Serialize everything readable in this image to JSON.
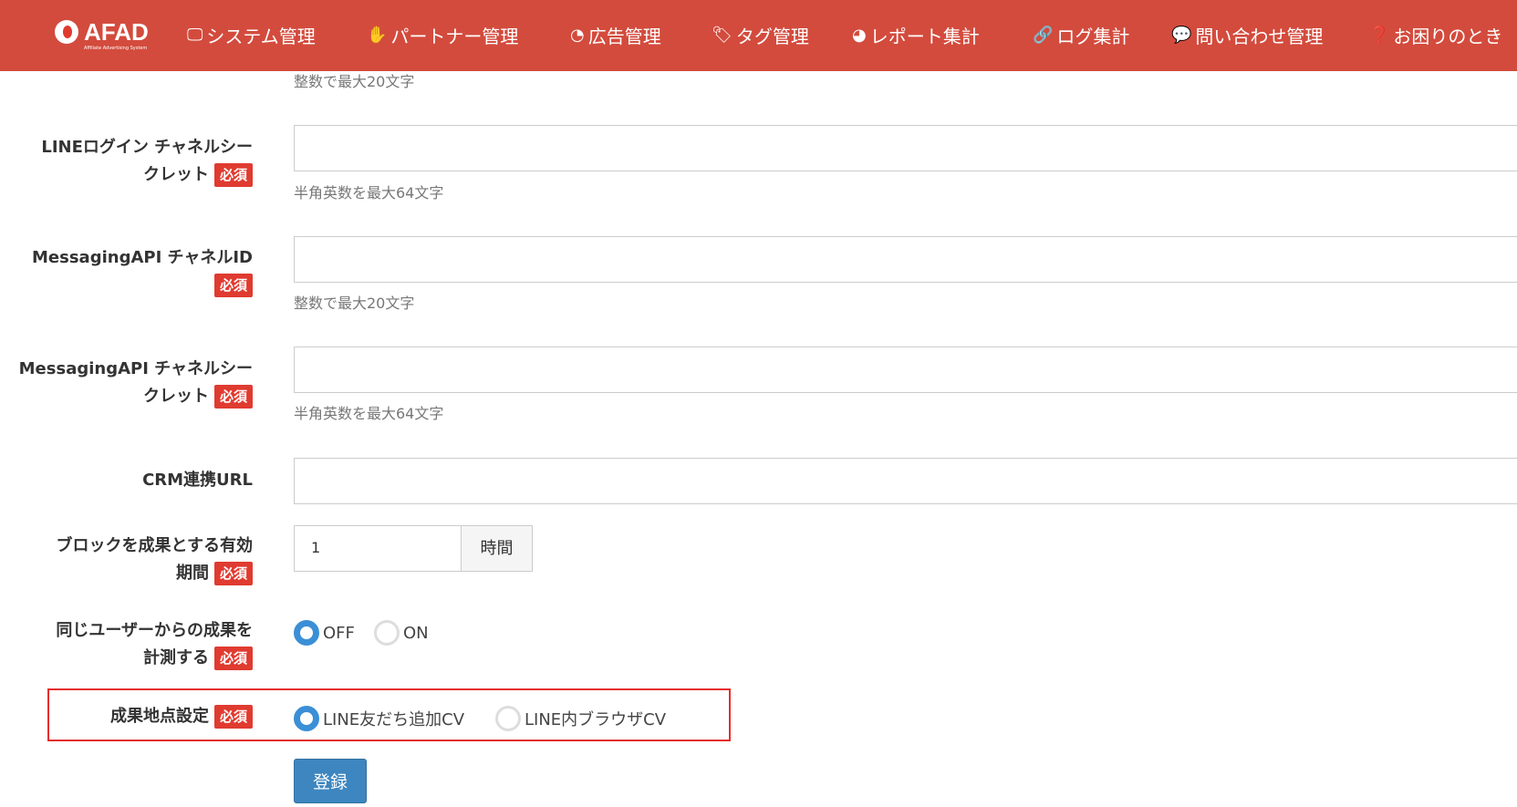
{
  "header": {
    "logo_text": "AFAD",
    "logo_subtext": "Affiliate Advertising System",
    "nav": [
      {
        "icon": "monitor-icon",
        "label": "システム管理"
      },
      {
        "icon": "handshake-icon",
        "label": "パートナー管理"
      },
      {
        "icon": "dashboard-icon",
        "label": "広告管理"
      },
      {
        "icon": "tags-icon",
        "label": "タグ管理"
      },
      {
        "icon": "pie-chart-icon",
        "label": "レポート集計"
      },
      {
        "icon": "link-icon",
        "label": "ログ集計"
      },
      {
        "icon": "comments-icon",
        "label": "問い合わせ管理"
      },
      {
        "icon": "question-circle-icon",
        "label": "お困りのとき"
      }
    ]
  },
  "required_label": "必須",
  "form": {
    "top_help": "整数で最大20文字",
    "line_login_secret": {
      "label1": "LINEログイン チャネルシー",
      "label2": "クレット",
      "value": "",
      "help": "半角英数を最大64文字"
    },
    "messaging_channel_id": {
      "label": "MessagingAPI チャネルID",
      "value": "",
      "help": "整数で最大20文字"
    },
    "messaging_secret": {
      "label1": "MessagingAPI チャネルシー",
      "label2": "クレット",
      "value": "",
      "help": "半角英数を最大64文字"
    },
    "crm_url": {
      "label": "CRM連携URL",
      "value": ""
    },
    "block_period": {
      "label1": "ブロックを成果とする有効",
      "label2": "期間",
      "value": "1",
      "unit": "時間"
    },
    "same_user": {
      "label1": "同じユーザーからの成果を",
      "label2": "計測する",
      "options": [
        "OFF",
        "ON"
      ],
      "selected": "OFF"
    },
    "conversion_point": {
      "label": "成果地点設定",
      "options": [
        "LINE友だち追加CV",
        "LINE内ブラウザCV"
      ],
      "selected": "LINE友だち追加CV"
    },
    "submit_label": "登録"
  }
}
